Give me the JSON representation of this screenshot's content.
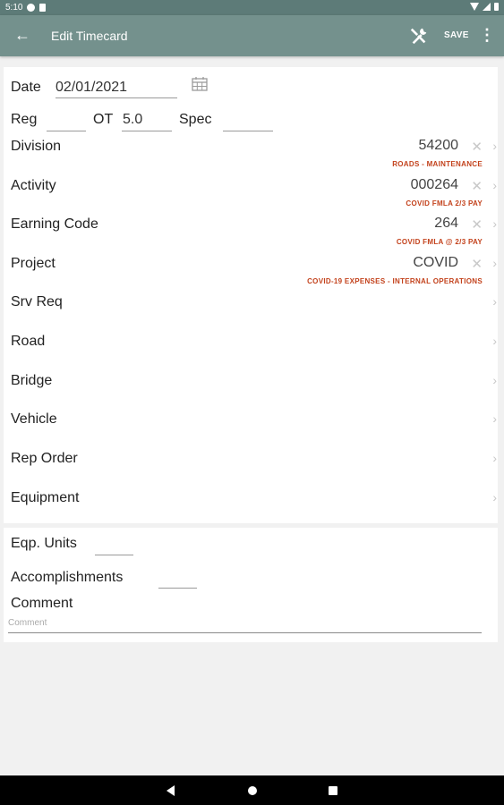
{
  "status_bar": {
    "time": "5:10"
  },
  "app_bar": {
    "back_icon": "arrow-back-icon",
    "title": "Edit Timecard",
    "tools_icon": "tools-icon",
    "save_label": "SAVE",
    "more_icon": "more-vert-icon"
  },
  "form": {
    "date": {
      "label": "Date",
      "value": "02/01/2021"
    },
    "hours": {
      "reg_label": "Reg",
      "reg_value": "",
      "ot_label": "OT",
      "ot_value": "5.0",
      "spec_label": "Spec",
      "spec_value": ""
    },
    "rows": [
      {
        "label": "Division",
        "value": "54200",
        "sub": "ROADS - MAINTENANCE"
      },
      {
        "label": "Activity",
        "value": "000264",
        "sub": "COVID FMLA 2/3 PAY"
      },
      {
        "label": "Earning Code",
        "value": "264",
        "sub": "COVID FMLA @ 2/3 PAY"
      },
      {
        "label": "Project",
        "value": "COVID",
        "sub": "COVID-19 EXPENSES - INTERNAL OPERATIONS"
      },
      {
        "label": "Srv Req"
      },
      {
        "label": "Road"
      },
      {
        "label": "Bridge"
      },
      {
        "label": "Vehicle"
      },
      {
        "label": "Rep Order"
      },
      {
        "label": "Equipment"
      }
    ],
    "eqp_units": {
      "label": "Eqp. Units",
      "value": ""
    },
    "accomplishments": {
      "label": "Accomplishments",
      "value": ""
    },
    "comment": {
      "label": "Comment",
      "placeholder": "Comment"
    }
  },
  "colors": {
    "app_bar": "#74918d",
    "status_bar": "#5d7b78",
    "sub_text": "#c3421c"
  }
}
